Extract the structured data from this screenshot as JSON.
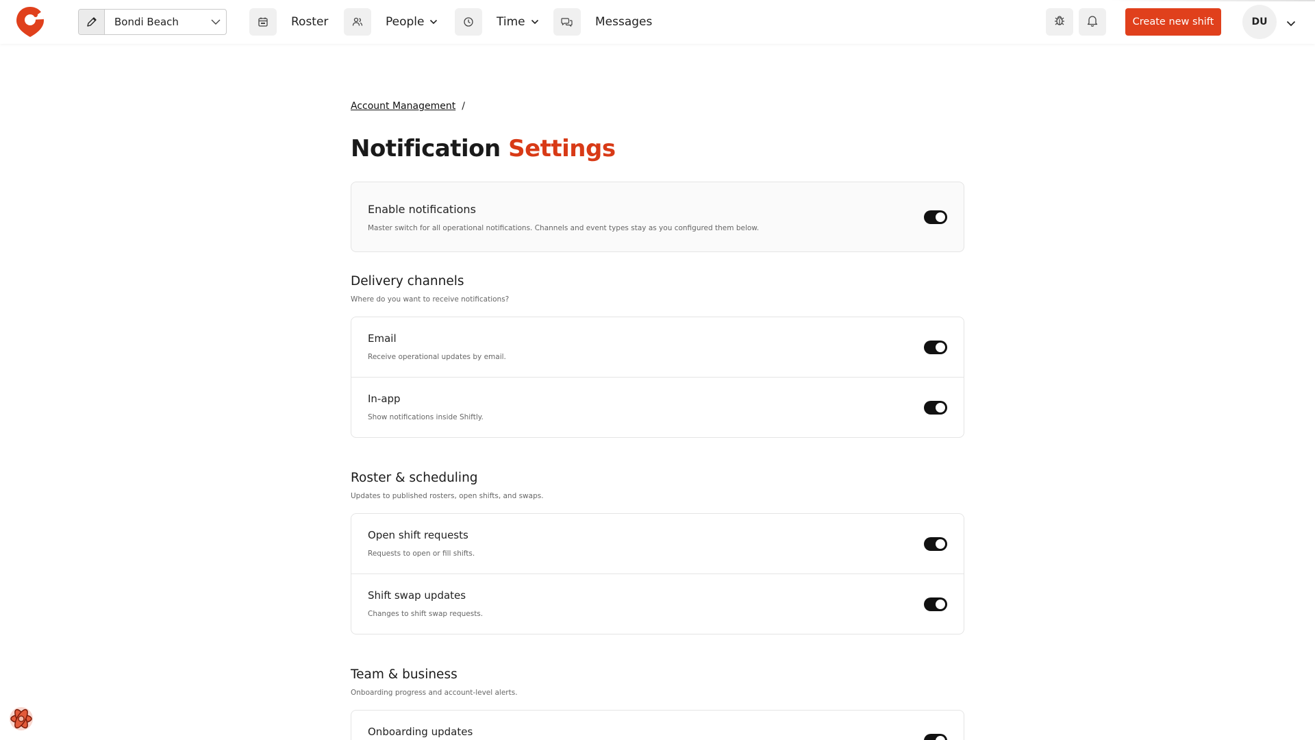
{
  "header": {
    "location": "Bondi Beach",
    "nav": [
      {
        "label": "Roster",
        "icon": "calendar-icon"
      },
      {
        "label": "People",
        "icon": "people-icon"
      },
      {
        "label": "Time",
        "icon": "clock-icon"
      },
      {
        "label": "Messages",
        "icon": "chat-icon"
      }
    ],
    "create_button": "Create new shift",
    "avatar_initials": "DU",
    "accent_color": "#e0401c"
  },
  "breadcrumb": {
    "parent": "Account Management",
    "separator": "/"
  },
  "page": {
    "title_main": "Notification",
    "title_accent": "Settings"
  },
  "master": {
    "title": "Enable notifications",
    "description": "Master switch for all operational notifications. Channels and event types stay as you configured them below.",
    "enabled": true
  },
  "sections": [
    {
      "heading": "Delivery channels",
      "subheading": "Where do you want to receive notifications?",
      "rows": [
        {
          "title": "Email",
          "description": "Receive operational updates by email.",
          "enabled": true
        },
        {
          "title": "In-app",
          "description": "Show notifications inside Shiftly.",
          "enabled": true
        }
      ]
    },
    {
      "heading": "Roster & scheduling",
      "subheading": "Updates to published rosters, open shifts, and swaps.",
      "rows": [
        {
          "title": "Open shift requests",
          "description": "Requests to open or fill shifts.",
          "enabled": true
        },
        {
          "title": "Shift swap updates",
          "description": "Changes to shift swap requests.",
          "enabled": true
        }
      ]
    },
    {
      "heading": "Team & business",
      "subheading": "Onboarding progress and account-level alerts.",
      "rows": [
        {
          "title": "Onboarding updates",
          "enabled": true
        }
      ]
    }
  ]
}
